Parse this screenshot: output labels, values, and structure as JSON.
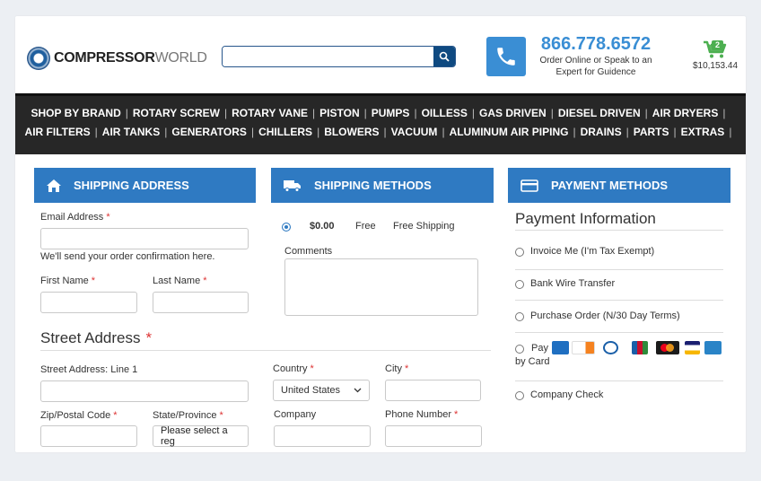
{
  "header": {
    "logo_bold": "COMPRESSOR",
    "logo_light": "WORLD",
    "search_placeholder": "",
    "phone_number": "866.778.6572",
    "phone_sub_line1": "Order Online or Speak to an",
    "phone_sub_line2": "Expert for Guidence",
    "cart_count": "2",
    "cart_total": "$10,153.44"
  },
  "nav": {
    "row1": [
      "SHOP BY BRAND",
      "ROTARY SCREW",
      "ROTARY VANE",
      "PISTON",
      "PUMPS",
      "OILLESS",
      "GAS DRIVEN",
      "DIESEL DRIVEN",
      "AIR DRYERS"
    ],
    "row2": [
      "AIR FILTERS",
      "AIR TANKS",
      "GENERATORS",
      "CHILLERS",
      "BLOWERS",
      "VACUUM",
      "ALUMINUM AIR PIPING",
      "DRAINS",
      "PARTS",
      "EXTRAS"
    ]
  },
  "shipping_address": {
    "title": "SHIPPING ADDRESS",
    "email_label": "Email Address",
    "email_value": "",
    "email_help": "We'll send your order confirmation here.",
    "first_name_label": "First Name",
    "last_name_label": "Last Name",
    "street_title": "Street Address",
    "street_line1_label": "Street Address: Line 1",
    "zip_label": "Zip/Postal Code",
    "state_label": "State/Province",
    "state_value": "Please select a reg",
    "country_label": "Country",
    "country_value": "United States",
    "city_label": "City",
    "company_label": "Company",
    "phone_label": "Phone Number",
    "required_mark": "*"
  },
  "shipping_methods": {
    "title": "SHIPPING METHODS",
    "option_price": "$0.00",
    "option_type": "Free",
    "option_name": "Free Shipping",
    "comments_label": "Comments"
  },
  "payment_methods": {
    "title": "PAYMENT METHODS",
    "heading": "Payment Information",
    "options": [
      "Invoice Me (I'm Tax Exempt)",
      "Bank Wire Transfer",
      "Purchase Order (N/30 Day Terms)",
      "Pay",
      "Company Check"
    ],
    "pay_by_card_suffix": "by Card",
    "card_brands": [
      "amex",
      "discover",
      "diners",
      "jcb",
      "mastercard",
      "visa",
      "amex-alt"
    ]
  },
  "colors": {
    "accent": "#2f7ac2",
    "navbar": "#272727",
    "cart_green": "#4caf50"
  }
}
